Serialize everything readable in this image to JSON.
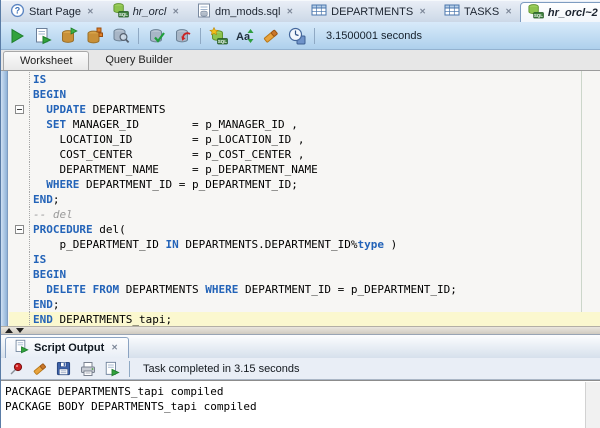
{
  "document_tabs": [
    {
      "label": "Start Page",
      "icon": "question-icon"
    },
    {
      "label": "hr_orcl",
      "icon": "sql-worksheet-icon"
    },
    {
      "label": "dm_mods.sql",
      "icon": "sql-file-icon"
    },
    {
      "label": "DEPARTMENTS",
      "icon": "table-icon"
    },
    {
      "label": "TASKS",
      "icon": "table-icon"
    },
    {
      "label": "hr_orcl~2",
      "icon": "sql-worksheet-icon",
      "active": true
    }
  ],
  "toolbar": {
    "buttons": [
      "run-statement",
      "run-script",
      "autotrace",
      "explain-plan",
      "sql-tuning-advisor",
      "commit",
      "rollback",
      "unshared-worksheet",
      "change-case",
      "clear",
      "sql-history"
    ],
    "timer": "3.1500001 seconds"
  },
  "worksheet_tabs": [
    {
      "label": "Worksheet",
      "active": true
    },
    {
      "label": "Query Builder",
      "active": false
    }
  ],
  "editor": {
    "lines": [
      {
        "seg": [
          {
            "t": "IS",
            "c": "kw"
          }
        ]
      },
      {
        "seg": [
          {
            "t": "BEGIN",
            "c": "kw"
          }
        ]
      },
      {
        "fold": true,
        "seg": [
          {
            "t": "  ",
            "c": "pl"
          },
          {
            "t": "UPDATE",
            "c": "kw"
          },
          {
            "t": " DEPARTMENTS",
            "c": "pl"
          }
        ]
      },
      {
        "seg": [
          {
            "t": "  ",
            "c": "pl"
          },
          {
            "t": "SET",
            "c": "kw"
          },
          {
            "t": " MANAGER_ID        = p_MANAGER_ID ,",
            "c": "pl"
          }
        ]
      },
      {
        "seg": [
          {
            "t": "    LOCATION_ID         = p_LOCATION_ID ,",
            "c": "pl"
          }
        ]
      },
      {
        "seg": [
          {
            "t": "    COST_CENTER         = p_COST_CENTER ,",
            "c": "pl"
          }
        ]
      },
      {
        "seg": [
          {
            "t": "    DEPARTMENT_NAME     = p_DEPARTMENT_NAME",
            "c": "pl"
          }
        ]
      },
      {
        "seg": [
          {
            "t": "  ",
            "c": "pl"
          },
          {
            "t": "WHERE",
            "c": "kw"
          },
          {
            "t": " DEPARTMENT_ID = p_DEPARTMENT_ID;",
            "c": "pl"
          }
        ]
      },
      {
        "seg": [
          {
            "t": "END",
            "c": "kw"
          },
          {
            "t": ";",
            "c": "pl"
          }
        ]
      },
      {
        "seg": [
          {
            "t": "-- del",
            "c": "cm"
          }
        ]
      },
      {
        "fold": true,
        "seg": [
          {
            "t": "PROCEDURE",
            "c": "kw"
          },
          {
            "t": " del(",
            "c": "pl"
          }
        ]
      },
      {
        "seg": [
          {
            "t": "    p_DEPARTMENT_ID ",
            "c": "pl"
          },
          {
            "t": "IN",
            "c": "kw"
          },
          {
            "t": " DEPARTMENTS.DEPARTMENT_ID%",
            "c": "pl"
          },
          {
            "t": "type",
            "c": "kw"
          },
          {
            "t": " )",
            "c": "pl"
          }
        ]
      },
      {
        "seg": [
          {
            "t": "IS",
            "c": "kw"
          }
        ]
      },
      {
        "seg": [
          {
            "t": "BEGIN",
            "c": "kw"
          }
        ]
      },
      {
        "seg": [
          {
            "t": "  ",
            "c": "pl"
          },
          {
            "t": "DELETE",
            "c": "kw"
          },
          {
            "t": " ",
            "c": "pl"
          },
          {
            "t": "FROM",
            "c": "kw"
          },
          {
            "t": " DEPARTMENTS ",
            "c": "pl"
          },
          {
            "t": "WHERE",
            "c": "kw"
          },
          {
            "t": " DEPARTMENT_ID = p_DEPARTMENT_ID;",
            "c": "pl"
          }
        ]
      },
      {
        "seg": [
          {
            "t": "END",
            "c": "kw"
          },
          {
            "t": ";",
            "c": "pl"
          }
        ]
      },
      {
        "highlight": true,
        "seg": [
          {
            "t": "END",
            "c": "kw"
          },
          {
            "t": " DEPARTMENTS_tapi;",
            "c": "pl"
          }
        ]
      }
    ]
  },
  "output_panel": {
    "tab_label": "Script Output",
    "toolbar_buttons": [
      "pin",
      "clear",
      "save",
      "print",
      "run-script"
    ],
    "status": "Task completed in 3.15 seconds",
    "lines": [
      "PACKAGE DEPARTMENTS_tapi compiled",
      "PACKAGE BODY DEPARTMENTS_tapi compiled"
    ]
  },
  "colors": {
    "toolbar_bg": "#bcd9f0",
    "keyword": "#2363b8",
    "comment": "#9a9a9a",
    "current_line_highlight": "#fbf8cf",
    "run_green": "#33a23d"
  }
}
